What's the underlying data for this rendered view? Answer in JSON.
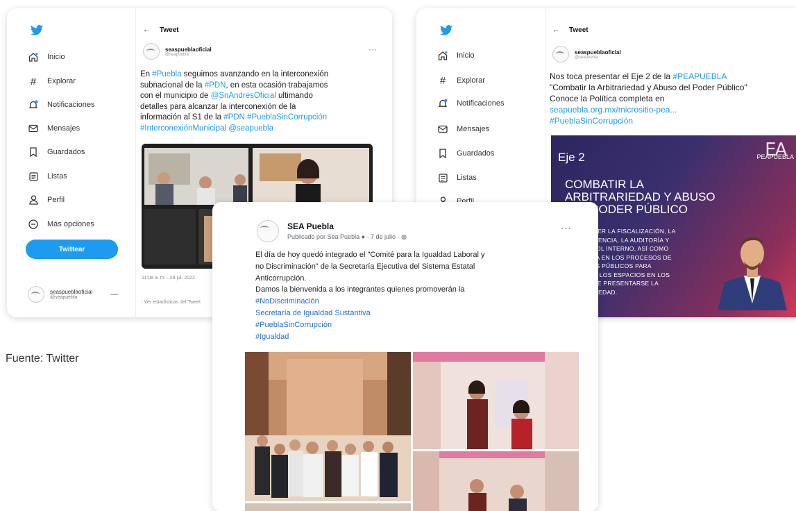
{
  "tweet1": {
    "sidebar": {
      "items": [
        "Inicio",
        "Explorar",
        "Notificaciones",
        "Mensajes",
        "Guardados",
        "Listas",
        "Perfil",
        "Más opciones"
      ],
      "tweet_button": "Twittear",
      "account_name": "seaspueblaoficial",
      "account_handle": "@seapuebla"
    },
    "header_title": "Tweet",
    "user_name": "seaspueblaoficial",
    "user_handle": "@seapuebla",
    "text": [
      [
        {
          "t": "En "
        },
        {
          "t": "#Puebla",
          "link": true
        },
        {
          "t": " seguimos avanzando en la interconexión"
        }
      ],
      [
        {
          "t": "subnacional de la "
        },
        {
          "t": "#PDN",
          "link": true
        },
        {
          "t": ", en esta ocasión trabajamos"
        }
      ],
      [
        {
          "t": "con el municipio de "
        },
        {
          "t": "@SnAndresOficial",
          "link": true
        },
        {
          "t": " ultimando"
        }
      ],
      [
        {
          "t": "detalles para alcanzar la interconexión de la"
        }
      ],
      [
        {
          "t": "información  al S1 de la "
        },
        {
          "t": "#PDN #PueblaSinCorrupción",
          "link": true
        }
      ],
      [
        {
          "t": "#InterconexiónMunicipal @seapuebla",
          "link": true
        }
      ]
    ],
    "timestamp": "11:08 a. m. · 28 jul. 2022 ·",
    "stats": "Ver estadísticas del Tweet"
  },
  "tweet2": {
    "sidebar": {
      "items": [
        "Inicio",
        "Explorar",
        "Notificaciones",
        "Mensajes",
        "Guardados",
        "Listas",
        "Perfil"
      ]
    },
    "header_title": "Tweet",
    "user_name": "seaspueblaoficial",
    "user_handle": "@seapuebla",
    "text": [
      [
        {
          "t": "Nos toca presentar el Eje 2 de la "
        },
        {
          "t": "#PEAPUEBLA",
          "link": true
        }
      ],
      [
        {
          "t": "\"Combatir la Arbitrariedad y Abuso del Poder Público\""
        }
      ],
      [
        {
          "t": "Conoce la Política completa en"
        }
      ],
      [
        {
          "t": "seapuebla.org.mx/micrositio-pea...",
          "link": true
        }
      ],
      [
        {
          "t": "#PueblaSinCorrupción",
          "link": true
        }
      ]
    ],
    "banner": {
      "eje": "Eje 2",
      "title_lines": [
        "COMBATIR LA",
        "ARBITRARIEDAD Y ABUSO",
        "DEL PODER PÚBLICO"
      ],
      "logo_mark": "EA",
      "logo_text": "PEAPUEBLA",
      "body_lines": [
        "FORTALECER LA FISCALIZACIÓN, LA",
        "TRANSPARENCIA, LA AUDITORÍA Y",
        "EL CONTROL INTERNO, ASÍ COMO",
        "LA MEJORA EN LOS PROCESOS DE",
        "LOS ENTES PÚBLICOS PARA",
        "DISMINUIR LOS ESPACIOS EN LOS",
        "QUE PUEDE PRESENTARSE LA",
        "ARBITRARIEDAD."
      ]
    }
  },
  "facebook": {
    "page_name": "SEA Puebla",
    "posted_by": "Publicado por Sea Puebla",
    "date": "· 7 de julio ·",
    "text_lines": [
      "El día de hoy quedó integrado el \"Comité para la Igualdad Laboral y",
      "no Discriminación\" de la Secretaría Ejecutiva del Sistema Estatal",
      "Anticorrupción.",
      "Damos la bienvenida a los integrantes quienes promoverán la"
    ],
    "tags": [
      "#NoDiscriminación",
      "Secretaría de Igualdad Sustantiva",
      "#PueblaSinCorrupción",
      "#Igualdad"
    ],
    "more": "···"
  },
  "caption": "Fuente: Twitter",
  "colors": {
    "twitter_blue": "#1d9bf0",
    "facebook_link": "#216fdb",
    "banner_purple": "#2c2660",
    "banner_pink": "#d6395a"
  }
}
